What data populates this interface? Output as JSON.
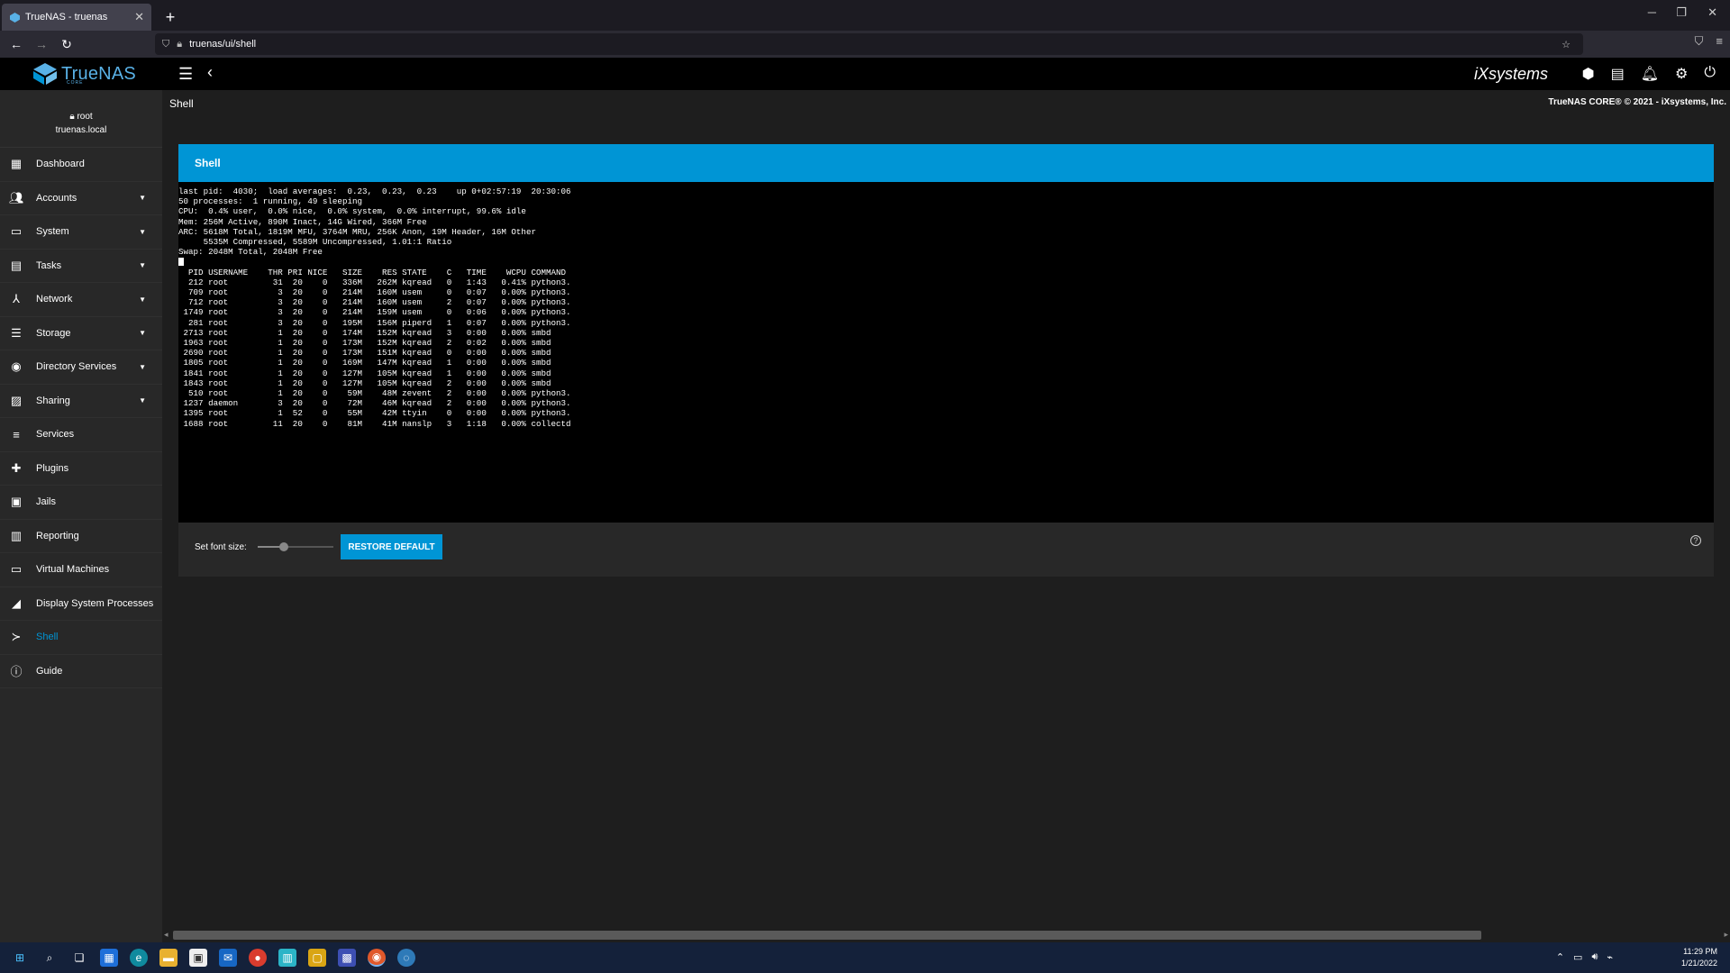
{
  "browser": {
    "tab_title": "TrueNAS - truenas",
    "new_tab": "+",
    "url": "truenas/ui/shell"
  },
  "header": {
    "logo_text": "TrueNAS",
    "logo_sub": "CORE",
    "vendor_logo": "iXsystems"
  },
  "user": {
    "name": "root",
    "host": "truenas.local"
  },
  "sidebar": {
    "items": [
      {
        "label": "Dashboard",
        "icon": "dashboard-icon",
        "has_caret": false
      },
      {
        "label": "Accounts",
        "icon": "accounts-icon",
        "has_caret": true
      },
      {
        "label": "System",
        "icon": "system-icon",
        "has_caret": true
      },
      {
        "label": "Tasks",
        "icon": "tasks-icon",
        "has_caret": true
      },
      {
        "label": "Network",
        "icon": "network-icon",
        "has_caret": true
      },
      {
        "label": "Storage",
        "icon": "storage-icon",
        "has_caret": true
      },
      {
        "label": "Directory Services",
        "icon": "directory-services-icon",
        "has_caret": true
      },
      {
        "label": "Sharing",
        "icon": "sharing-icon",
        "has_caret": true
      },
      {
        "label": "Services",
        "icon": "services-icon",
        "has_caret": false
      },
      {
        "label": "Plugins",
        "icon": "plugins-icon",
        "has_caret": false
      },
      {
        "label": "Jails",
        "icon": "jails-icon",
        "has_caret": false
      },
      {
        "label": "Reporting",
        "icon": "reporting-icon",
        "has_caret": false
      },
      {
        "label": "Virtual Machines",
        "icon": "virtual-machines-icon",
        "has_caret": false
      },
      {
        "label": "Display System Processes",
        "icon": "processes-icon",
        "has_caret": false
      },
      {
        "label": "Shell",
        "icon": "shell-icon",
        "has_caret": false,
        "active": true
      },
      {
        "label": "Guide",
        "icon": "guide-icon",
        "has_caret": false
      }
    ]
  },
  "page": {
    "title": "Shell",
    "copyright": "TrueNAS CORE® © 2021 - iXsystems, Inc."
  },
  "shell_card": {
    "title": "Shell",
    "terminal_lines": [
      "last pid:  4030;  load averages:  0.23,  0.23,  0.23    up 0+02:57:19  20:30:06",
      "50 processes:  1 running, 49 sleeping",
      "CPU:  0.4% user,  0.0% nice,  0.0% system,  0.0% interrupt, 99.6% idle",
      "Mem: 256M Active, 890M Inact, 14G Wired, 366M Free",
      "ARC: 5618M Total, 1819M MFU, 3764M MRU, 256K Anon, 19M Header, 16M Other",
      "     5535M Compressed, 5589M Uncompressed, 1.01:1 Ratio",
      "Swap: 2048M Total, 2048M Free"
    ],
    "process_header": "  PID USERNAME    THR PRI NICE   SIZE    RES STATE    C   TIME    WCPU COMMAND",
    "process_rows": [
      "  212 root         31  20    0   336M   262M kqread   0   1:43   0.41% python3.",
      "  709 root          3  20    0   214M   160M usem     0   0:07   0.00% python3.",
      "  712 root          3  20    0   214M   160M usem     2   0:07   0.00% python3.",
      " 1749 root          3  20    0   214M   159M usem     0   0:06   0.00% python3.",
      "  281 root          3  20    0   195M   156M piperd   1   0:07   0.00% python3.",
      " 2713 root          1  20    0   174M   152M kqread   3   0:00   0.00% smbd",
      " 1963 root          1  20    0   173M   152M kqread   2   0:02   0.00% smbd",
      " 2690 root          1  20    0   173M   151M kqread   0   0:00   0.00% smbd",
      " 1805 root          1  20    0   169M   147M kqread   1   0:00   0.00% smbd",
      " 1841 root          1  20    0   127M   105M kqread   1   0:00   0.00% smbd",
      " 1843 root          1  20    0   127M   105M kqread   2   0:00   0.00% smbd",
      "  510 root          1  20    0    59M    48M zevent   2   0:00   0.00% python3.",
      " 1237 daemon        3  20    0    72M    46M kqread   2   0:00   0.00% python3.",
      " 1395 root          1  52    0    55M    42M ttyin    0   0:00   0.00% python3.",
      " 1688 root         11  20    0    81M    41M nanslp   3   1:18   0.00% collectd"
    ],
    "font_size_label": "Set font size:",
    "font_size_level": 0.35,
    "restore_button": "RESTORE DEFAULT"
  },
  "taskbar": {
    "time": "11:29 PM",
    "date": "1/21/2022"
  },
  "colors": {
    "accent": "#0095d5",
    "logo": "#59b1e6",
    "terminal_bg": "#000000"
  }
}
